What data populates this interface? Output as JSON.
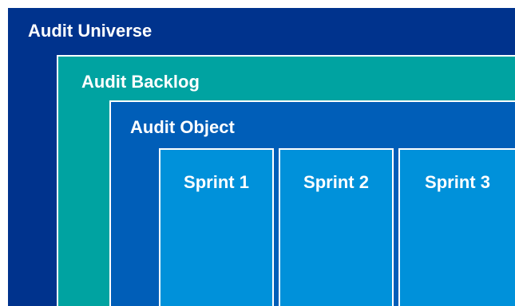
{
  "layers": {
    "universe": {
      "label": "Audit Universe",
      "color": "#00338d"
    },
    "backlog": {
      "label": "Audit Backlog",
      "color": "#00a3a1"
    },
    "object": {
      "label": "Audit Object",
      "color": "#005eb8"
    }
  },
  "sprints": [
    {
      "label": "Sprint 1",
      "color": "#0091da"
    },
    {
      "label": "Sprint 2",
      "color": "#0091da"
    },
    {
      "label": "Sprint 3",
      "color": "#0091da"
    }
  ]
}
